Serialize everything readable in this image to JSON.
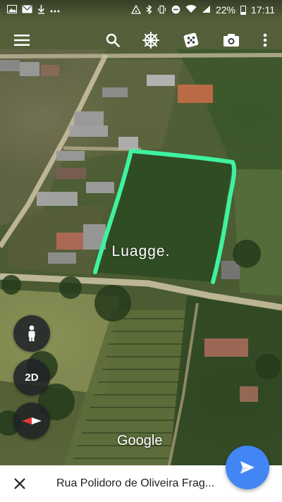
{
  "status_bar": {
    "battery_percent": "22%",
    "time": "17:11",
    "left_icons": [
      "photo-icon",
      "mail-icon",
      "download-icon",
      "more-dots-icon"
    ],
    "right_icons": [
      "alarm-icon",
      "bluetooth-icon",
      "vibrate-icon",
      "dnd-icon",
      "wifi-icon",
      "signal-icon",
      "battery-icon"
    ]
  },
  "toolbar": {
    "icons": [
      "menu-icon",
      "search-icon",
      "steering-wheel-icon",
      "dice-icon",
      "camera-icon",
      "overflow-menu-icon"
    ]
  },
  "map": {
    "watermark": "Luagge.",
    "logo": "Google",
    "outline_color": "#3ff2a0"
  },
  "controls": {
    "pegman_icon": "pegman-icon",
    "mode_label": "2D",
    "compass_icon": "compass-icon",
    "send_icon": "send-icon",
    "send_color": "#4285f4"
  },
  "bottom_bar": {
    "close_icon": "close-icon",
    "address": "Rua Polidoro de Oliveira Frag..."
  }
}
